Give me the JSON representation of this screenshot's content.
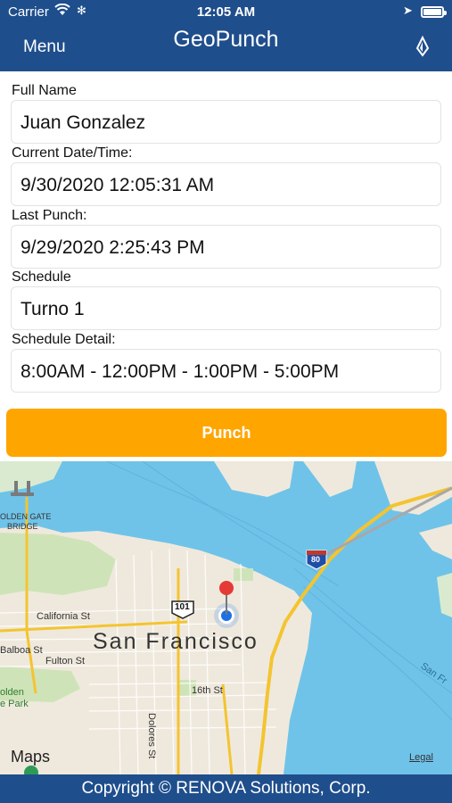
{
  "status_bar": {
    "carrier": "Carrier",
    "time": "12:05 AM",
    "battery_level": 1.0
  },
  "nav": {
    "menu_label": "Menu",
    "title": "GeoPunch",
    "location_icon": "location-pin-icon"
  },
  "form": {
    "full_name_label": "Full Name",
    "full_name_value": "Juan Gonzalez",
    "current_label": "Current Date/Time:",
    "current_value": "9/30/2020 12:05:31 AM",
    "last_punch_label": "Last Punch:",
    "last_punch_value": "9/29/2020 2:25:43 PM",
    "schedule_label": "Schedule",
    "schedule_value": "Turno 1",
    "schedule_detail_label": "Schedule Detail:",
    "schedule_detail_value": "8:00AM - 12:00PM - 1:00PM - 5:00PM"
  },
  "punch_label": "Punch",
  "map": {
    "city": "San Francisco",
    "labels": {
      "golden_gate_1": "OLDEN GATE",
      "golden_gate_2": "BRIDGE",
      "california": "California St",
      "balboa": "Balboa St",
      "fulton": "Fulton St",
      "golden_1": "olden",
      "golden_2": "e Park",
      "sixteenth": "16th St",
      "dolores": "Dolores St",
      "san_fr": "San Fr",
      "hwy_101": "101",
      "hwy_80": "80"
    },
    "brand": "Maps",
    "legal": "Legal"
  },
  "footer": "Copyright © RENOVA Solutions, Corp.",
  "colors": {
    "nav_bg": "#1f4e8c",
    "punch_bg": "#ffa500",
    "water": "#6fc3e9",
    "land": "#efe9dd"
  }
}
